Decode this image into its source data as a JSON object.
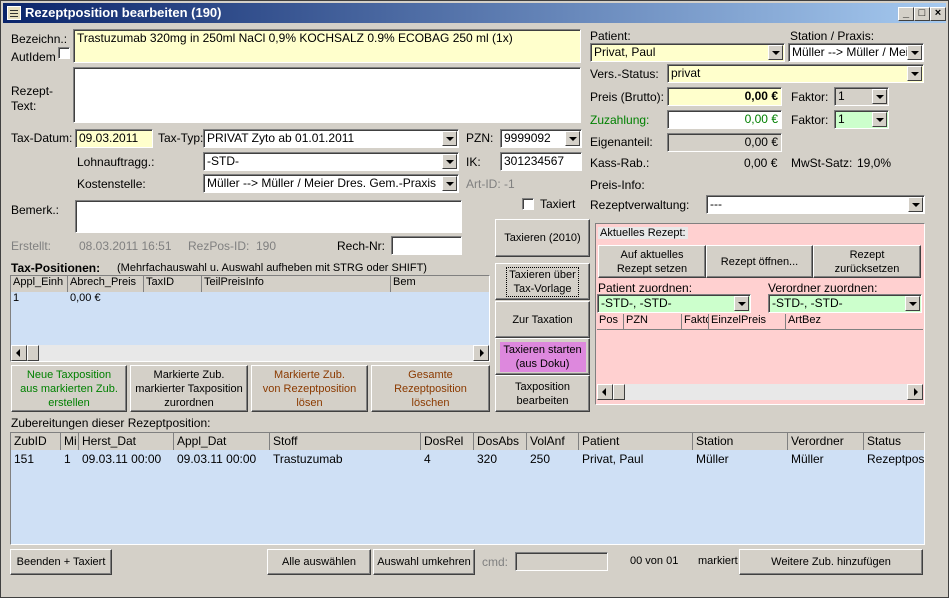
{
  "window": {
    "title": "Rezeptposition bearbeiten (190)"
  },
  "left": {
    "bezeichn_label": "Bezeichn.:",
    "bezeichn_value": "Trastuzumab 320mg in 250ml NaCl 0,9% KOCHSALZ 0.9% ECOBAG 250 ml (1x)",
    "autidem_label": "AutIdem",
    "rezept_text_label1": "Rezept-",
    "rezept_text_label2": "Text:",
    "taxdatum_label": "Tax-Datum:",
    "taxdatum_value": "09.03.2011",
    "taxtyp_label": "Tax-Typ:",
    "taxtyp_value": "PRIVAT Zyto ab 01.01.2011",
    "pzn_label": "PZN:",
    "pzn_value": "9999092",
    "lohn_label": "Lohnauftragg.:",
    "lohn_value": "-STD-",
    "ik_label": "IK:",
    "ik_value": "301234567",
    "kosten_label": "Kostenstelle:",
    "kosten_value": "Müller --> Müller / Meier Dres. Gem.-Praxis",
    "artid_label": "Art-ID: -1",
    "bemerk_label": "Bemerk.:",
    "erstellt_label": "Erstellt:",
    "erstellt_value": "08.03.2011 16:51",
    "rezpos_label": "RezPos-ID:",
    "rezpos_value": "190",
    "rechnr_label": "Rech-Nr:"
  },
  "taxpos": {
    "title": "Tax-Positionen:",
    "hint": "(Mehrfachauswahl u. Auswahl aufheben mit STRG oder SHIFT)",
    "columns": [
      "Appl_Einh",
      "Abrech_Preis",
      "TaxID",
      "TeilPreisInfo",
      "Bem"
    ],
    "rows": [
      [
        "1",
        "0,00 €",
        "",
        "",
        ""
      ]
    ]
  },
  "buttons": {
    "neue1": "Neue Taxposition",
    "neue2": "aus markierten Zub.",
    "neue3": "erstellen",
    "markiert1": "Markierte Zub.",
    "markiert2": "markierter Taxposition",
    "markiert3": "zurordnen",
    "loesen1": "Markierte Zub.",
    "loesen2": "von Rezeptposition",
    "loesen3": "lösen",
    "gesamt1": "Gesamte",
    "gesamt2": "Rezeptposition",
    "gesamt3": "löschen",
    "taxiert_label": "Taxiert",
    "taxieren2010": "Taxieren (2010)",
    "vorlage1": "Taxieren über",
    "vorlage2": "Tax-Vorlage",
    "zurtaxation": "Zur Taxation",
    "starten1": "Taxieren starten",
    "starten2": "(aus Doku)",
    "bearbeiten1": "Taxposition",
    "bearbeiten2": "bearbeiten",
    "beenden": "Beenden + Taxiert",
    "alle": "Alle auswählen",
    "umkehren": "Auswahl umkehren",
    "cmd_label": "cmd:",
    "counter": "00 von 01",
    "markiert_label": "markiert",
    "weitere": "Weitere Zub. hinzufügen"
  },
  "right": {
    "patient_label": "Patient:",
    "patient_value": "Privat, Paul",
    "station_label": "Station / Praxis:",
    "station_value": "Müller --> Müller / Meier",
    "vers_label": "Vers.-Status:",
    "vers_value": "privat",
    "preis_label": "Preis (Brutto):",
    "preis_value": "0,00 €",
    "faktor_label": "Faktor:",
    "faktor1": "1",
    "zuzahlung_label": "Zuzahlung:",
    "zuzahlung_value": "0,00 €",
    "faktor2": "1",
    "eigen_label": "Eigenanteil:",
    "eigen_value": "0,00 €",
    "kass_label": "Kass-Rab.:",
    "kass_value": "0,00 €",
    "mwst_label": "MwSt-Satz:",
    "mwst_value": "19,0%",
    "preisinfo_label": "Preis-Info:",
    "rezeptverw_label": "Rezeptverwaltung:",
    "rezeptverw_value": "---"
  },
  "aktuell": {
    "title": "Aktuelles Rezept:",
    "btn_set1": "Auf aktuelles",
    "btn_set2": "Rezept setzen",
    "btn_open": "Rezept öffnen...",
    "btn_reset1": "Rezept",
    "btn_reset2": "zurücksetzen",
    "patient_zuordnen": "Patient zuordnen:",
    "patient_zuordnen_value": "-STD-, -STD-",
    "verordner_zuordnen": "Verordner zuordnen:",
    "verordner_zuordnen_value": "-STD-, -STD-",
    "columns": [
      "Pos",
      "PZN",
      "Fakto",
      "EinzelPreis",
      "ArtBez"
    ]
  },
  "zub": {
    "title": "Zubereitungen dieser Rezeptposition:",
    "columns": [
      "ZubID",
      "Mi",
      "Herst_Dat",
      "Appl_Dat",
      "Stoff",
      "DosRel",
      "DosAbs",
      "VolAnf",
      "Patient",
      "Station",
      "Verordner",
      "Status"
    ],
    "rows": [
      [
        "151",
        "1",
        "09.03.11 00:00",
        "09.03.11 00:00",
        "Trastuzumab",
        "4",
        "320",
        "250",
        "Privat, Paul",
        "Müller",
        "Müller",
        "Rezeptpos"
      ]
    ]
  },
  "colors": {
    "yellow": "#ffffcc",
    "green": "#ccffcc",
    "pink": "#ffd0d0",
    "grid": "#cfe0f5",
    "magenta": "#dd88dd"
  }
}
